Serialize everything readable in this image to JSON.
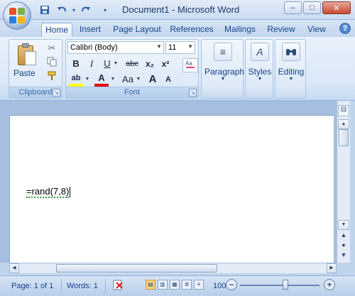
{
  "window": {
    "title": "Document1 - Microsoft Word",
    "minimize": "–",
    "maximize": "□",
    "close": "✕"
  },
  "qat": {
    "undo_dropdown": "▾",
    "customize": "▾"
  },
  "tabs": [
    {
      "label": "Home",
      "active": true
    },
    {
      "label": "Insert"
    },
    {
      "label": "Page Layout"
    },
    {
      "label": "References"
    },
    {
      "label": "Mailings"
    },
    {
      "label": "Review"
    },
    {
      "label": "View"
    }
  ],
  "ribbon": {
    "clipboard": {
      "label": "Clipboard",
      "paste": "Paste"
    },
    "font": {
      "label": "Font",
      "font_name": "Calibri (Body)",
      "font_size": "11",
      "bold": "B",
      "italic": "I",
      "underline": "U",
      "strikethrough": "abc",
      "subscript": "x₂",
      "superscript": "x²",
      "highlight": "ab",
      "font_color": "A",
      "change_case": "Aa",
      "grow": "A",
      "shrink": "A"
    },
    "paragraph": {
      "label": "Paragraph"
    },
    "styles": {
      "label": "Styles"
    },
    "editing": {
      "label": "Editing"
    }
  },
  "document": {
    "text": "=rand(7,8)"
  },
  "statusbar": {
    "page": "Page: 1 of 1",
    "words": "Words: 1",
    "zoom": "100%",
    "zoom_out": "−",
    "zoom_in": "+",
    "zoom_level": 1.0
  },
  "colors": {
    "accent": "#15428b",
    "ribbon_bg": "#dbe8f7",
    "font_color_bar": "#e00000",
    "highlight_bar": "#ffff00"
  }
}
